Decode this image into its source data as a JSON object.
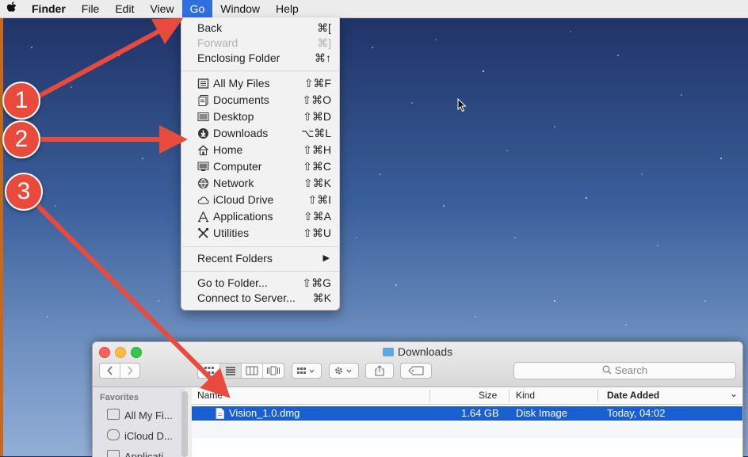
{
  "menubar": {
    "apple_icon": "apple-icon",
    "items": [
      {
        "label": "Finder"
      },
      {
        "label": "File"
      },
      {
        "label": "Edit"
      },
      {
        "label": "View"
      },
      {
        "label": "Go"
      },
      {
        "label": "Window"
      },
      {
        "label": "Help"
      }
    ],
    "active": "Go"
  },
  "go_menu": {
    "group1": [
      {
        "label": "Back",
        "shortcut": "⌘[",
        "enabled": true
      },
      {
        "label": "Forward",
        "shortcut": "⌘]",
        "enabled": false
      },
      {
        "label": "Enclosing Folder",
        "shortcut": "⌘↑",
        "enabled": true
      }
    ],
    "group2": [
      {
        "label": "All My Files",
        "shortcut": "⇧⌘F",
        "icon": "all-my-files-icon"
      },
      {
        "label": "Documents",
        "shortcut": "⇧⌘O",
        "icon": "documents-icon"
      },
      {
        "label": "Desktop",
        "shortcut": "⇧⌘D",
        "icon": "desktop-icon"
      },
      {
        "label": "Downloads",
        "shortcut": "⌥⌘L",
        "icon": "downloads-icon"
      },
      {
        "label": "Home",
        "shortcut": "⇧⌘H",
        "icon": "home-icon"
      },
      {
        "label": "Computer",
        "shortcut": "⇧⌘C",
        "icon": "computer-icon"
      },
      {
        "label": "Network",
        "shortcut": "⇧⌘K",
        "icon": "network-icon"
      },
      {
        "label": "iCloud Drive",
        "shortcut": "⇧⌘I",
        "icon": "icloud-icon"
      },
      {
        "label": "Applications",
        "shortcut": "⇧⌘A",
        "icon": "applications-icon"
      },
      {
        "label": "Utilities",
        "shortcut": "⇧⌘U",
        "icon": "utilities-icon"
      }
    ],
    "group3": [
      {
        "label": "Recent Folders",
        "submenu_arrow": "▶"
      }
    ],
    "group4": [
      {
        "label": "Go to Folder...",
        "shortcut": "⇧⌘G"
      },
      {
        "label": "Connect to Server...",
        "shortcut": "⌘K"
      }
    ]
  },
  "annotations": [
    {
      "number": "1"
    },
    {
      "number": "2"
    },
    {
      "number": "3"
    }
  ],
  "annotation_color": "#e84b3c",
  "finder": {
    "title": "Downloads",
    "search_placeholder": "Search",
    "sidebar": {
      "heading": "Favorites",
      "items": [
        {
          "label": "All My Fi..."
        },
        {
          "label": "iCloud D..."
        },
        {
          "label": "Applicati..."
        }
      ]
    },
    "columns": [
      "Name",
      "Size",
      "Kind",
      "Date Added"
    ],
    "sort_indicator": "⌄",
    "rows": [
      {
        "name": "Vision_1.0.dmg",
        "size": "1.64 GB",
        "kind": "Disk Image",
        "date_added": "Today, 04:02",
        "selected": true
      }
    ]
  },
  "colors": {
    "menu_highlight": "#2f6fe0",
    "selection": "#1a5fd2"
  }
}
